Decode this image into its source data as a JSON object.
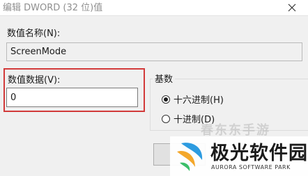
{
  "dialog": {
    "title": "编辑 DWORD (32 位)值",
    "value_name_label": "数值名称(N):",
    "value_name": "ScreenMode",
    "value_data_label": "数值数据(V):",
    "value_data": "0",
    "base_group_label": "基数",
    "base_options": [
      {
        "label": "十六进制(H)",
        "selected": true
      },
      {
        "label": "十进制(D)",
        "selected": false
      }
    ],
    "highlight_color": "#d23a3a"
  },
  "watermark": {
    "top_text": "春东东手游",
    "logo_name": "极光软件园",
    "logo_subtitle": "AURORA SOFTWARE PARK"
  }
}
